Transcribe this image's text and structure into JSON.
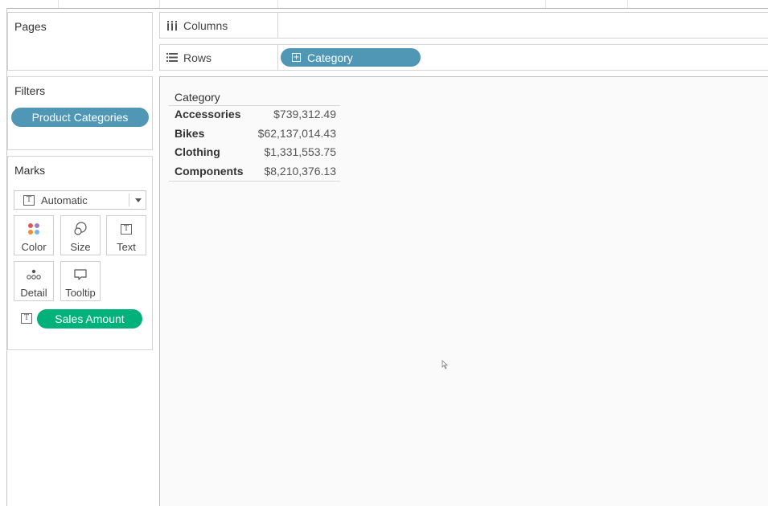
{
  "pages_card": {
    "title": "Pages"
  },
  "filters_card": {
    "title": "Filters",
    "pills": [
      "Product Categories"
    ]
  },
  "marks_card": {
    "title": "Marks",
    "mark_type": "Automatic",
    "buttons": [
      {
        "label": "Color",
        "icon": "color-dots-icon"
      },
      {
        "label": "Size",
        "icon": "size-circles-icon"
      },
      {
        "label": "Text",
        "icon": "text-box-icon"
      },
      {
        "label": "Detail",
        "icon": "detail-dots-icon"
      },
      {
        "label": "Tooltip",
        "icon": "tooltip-bubble-icon"
      }
    ],
    "fields": [
      {
        "type_icon": "text-box-icon",
        "label": "Sales Amount"
      }
    ]
  },
  "columns_shelf": {
    "label": "Columns",
    "icon": "columns-icon"
  },
  "rows_shelf": {
    "label": "Rows",
    "icon": "rows-icon",
    "pills": [
      {
        "expand_icon": "expand-plus-icon",
        "label": "Category"
      }
    ]
  },
  "view": {
    "header": "Category",
    "rows": [
      {
        "category": "Accessories",
        "value": "$739,312.49"
      },
      {
        "category": "Bikes",
        "value": "$62,137,014.43"
      },
      {
        "category": "Clothing",
        "value": "$1,331,553.75"
      },
      {
        "category": "Components",
        "value": "$8,210,376.13"
      }
    ]
  },
  "colors": {
    "dimension_pill": "#4f97b4",
    "measure_pill": "#00b17a",
    "color_dots": [
      "#e15759",
      "#9c7ec4",
      "#f28e2b",
      "#76b7e2"
    ]
  }
}
